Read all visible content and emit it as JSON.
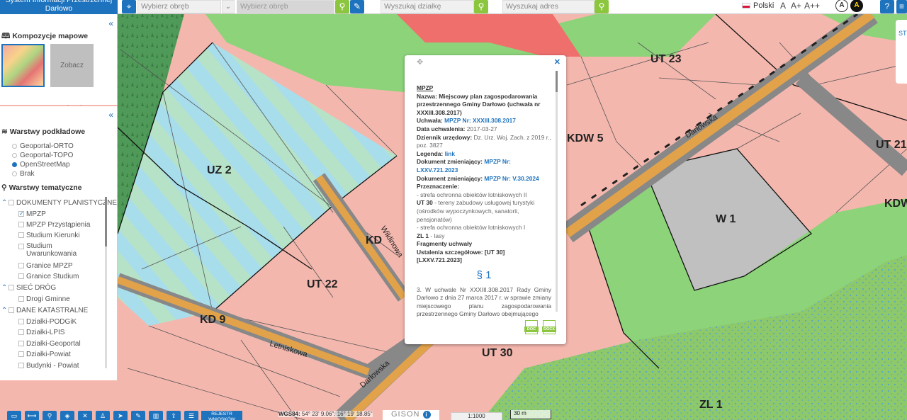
{
  "header": {
    "app_title": "System Informacji Przestrzennej Darłowo",
    "obreb1_placeholder": "Wybierz obręb",
    "obreb2_placeholder": "Wybierz obręb",
    "dzialka_placeholder": "Wyszukaj działkę",
    "adres_placeholder": "Wyszukaj adres",
    "language": "Polski",
    "font_small": "A",
    "font_medium": "A+",
    "font_large": "A++",
    "contrast1": "A",
    "contrast2": "A",
    "help": "?"
  },
  "compositions": {
    "title": "Kompozycje mapowe",
    "more": "Zobacz więcej"
  },
  "base_layers": {
    "title": "Warstwy podkładowe",
    "items": [
      {
        "label": "Geoportal-ORTO",
        "selected": false
      },
      {
        "label": "Geoportal-TOPO",
        "selected": false
      },
      {
        "label": "OpenStreetMap",
        "selected": true
      },
      {
        "label": "Brak",
        "selected": false
      }
    ]
  },
  "thematic_layers": {
    "title": "Warstwy tematyczne",
    "groups": [
      {
        "label": "DOKUMENTY PLANISTYCZNE",
        "items": [
          {
            "label": "MPZP",
            "checked": true
          },
          {
            "label": "MPZP Przystąpienia",
            "checked": false
          },
          {
            "label": "Studium Kierunki",
            "checked": false
          },
          {
            "label": "Studium Uwarunkowania",
            "checked": false
          },
          {
            "label": "Granice MPZP",
            "checked": false
          },
          {
            "label": "Granice Studium",
            "checked": false
          }
        ]
      },
      {
        "label": "SIEĆ DRÓG",
        "items": [
          {
            "label": "Drogi Gminne",
            "checked": false
          }
        ]
      },
      {
        "label": "DANE KATASTRALNE",
        "items": [
          {
            "label": "Działki-PODGiK",
            "checked": false
          },
          {
            "label": "Działki-LPIS",
            "checked": false
          },
          {
            "label": "Działki-Geoportal",
            "checked": false
          },
          {
            "label": "Działki-Powiat",
            "checked": false
          },
          {
            "label": "Budynki - Powiat",
            "checked": false
          }
        ]
      }
    ]
  },
  "popup": {
    "heading": "MPZP",
    "nazwa_label": "Nazwa:",
    "nazwa_value": "Miejscowy plan zagospodarowania przestrzennego Gminy Darłowo (uchwała nr XXXIII.308.2017)",
    "uchwala_label": "Uchwała:",
    "uchwala_value": "MPZP Nr: XXXIII.308.2017",
    "data_label": "Data uchwalenia:",
    "data_value": "2017-03-27",
    "dziennik_label": "Dziennik urzędowy:",
    "dziennik_value": "Dz. Urz. Woj. Zach. z 2019 r., poz. 3827",
    "legenda_label": "Legenda:",
    "legenda_value": "link",
    "dok1_label": "Dokument zmieniający:",
    "dok1_value": "MPZP Nr: LXXV.721.2023",
    "dok2_label": "Dokument zmieniający:",
    "dok2_value": "MPZP Nr: V.30.2024",
    "przeznaczenie_label": "Przeznaczenie:",
    "p1": "- strefa ochronna obiektów lotniskowych II",
    "p2_code": "UT 30",
    "p2_text": "- tereny zabudowy usługowej turystyki (ośrodków wypoczynkowych, sanatorii, pensjonatów)",
    "p3": "- strefa ochronna obiektów lotniskowych I",
    "p4_code": "ZL 1",
    "p4_text": "- lasy",
    "fragmenty": "Fragmenty uchwały",
    "ustalenia_label": "Ustalenia szczegółowe:",
    "ustalenia_value": "[UT 30] [LXXV.721.2023]",
    "paragraph": "§ 1",
    "body_text": "3. W uchwale Nr XXXIII.308.2017 Rady Gminy Darłowo z dnia 27 marca 2017 r. w sprawie zmiany miejscowego planu zagospodarowania przestrzennego Gminy Darłowo obejmującego",
    "doc_label": "DOC",
    "docx_label": "DOCX"
  },
  "map": {
    "zones": [
      "UZ 2",
      "UT 22",
      "UT 23",
      "UT 30",
      "W 1",
      "ZL 1",
      "KDW 5",
      "UT 21",
      "KDW",
      "KD",
      "KD 9"
    ],
    "streets": [
      "Darłowska",
      "Letniskowa",
      "Wiklinowa",
      "Nadmorska"
    ],
    "colors": {
      "ut": "#f4b7ae",
      "zl": "#8dc96b",
      "uz": "#b7e4cf",
      "w": "#c0c0c0",
      "road": "#e2a24a",
      "red": "#ef6f6c",
      "green": "#6cc25a"
    }
  },
  "footer": {
    "rejestr": "REJESTR WNIOSKÓW",
    "coords_label": "WGS84:",
    "coords_value": "54° 23' 9.06\", 16° 19' 18.85\"",
    "brand": "GISON",
    "scale": "1:1000",
    "scalebar": "30 m"
  },
  "right_panel": {
    "label": "ST"
  }
}
